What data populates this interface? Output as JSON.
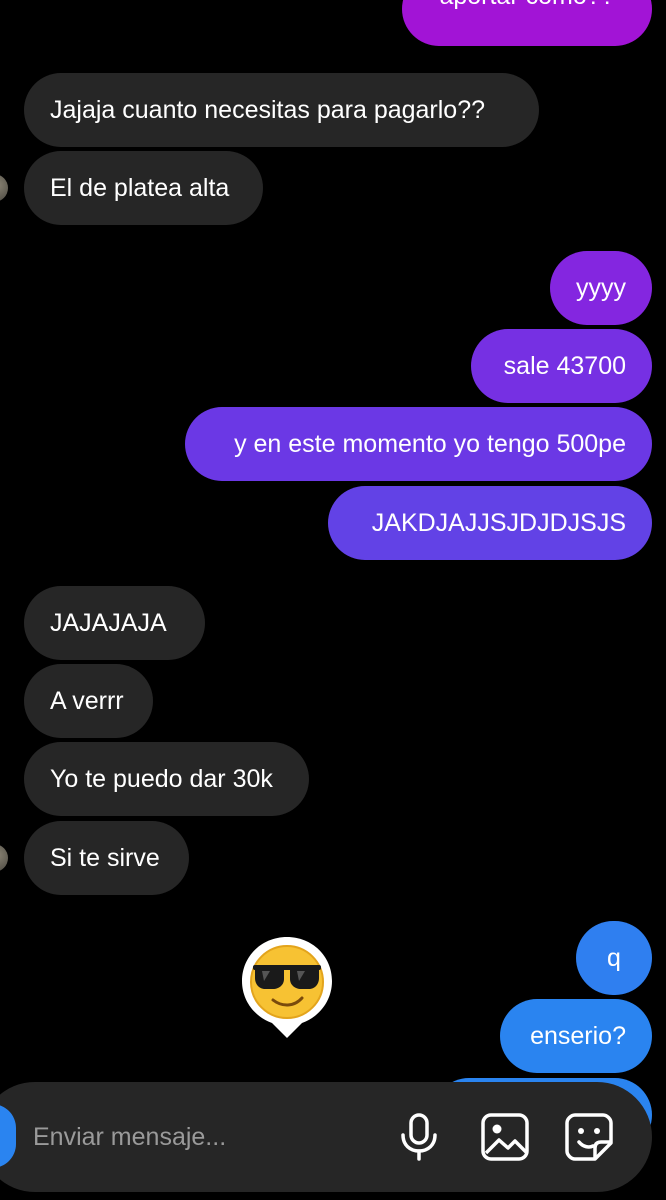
{
  "thread": {
    "partial_top_message": "aportar como??",
    "messages": [
      {
        "from": "them",
        "text": "Jajaja cuanto necesitas para pagarlo??"
      },
      {
        "from": "them",
        "text": "El de platea alta"
      },
      {
        "from": "me",
        "text": "yyyy"
      },
      {
        "from": "me",
        "text": "sale 43700"
      },
      {
        "from": "me",
        "text": "y en este momento yo tengo 500pe"
      },
      {
        "from": "me",
        "text": "JAKDJAJJSJDJDJSJS"
      },
      {
        "from": "them",
        "text": "JAJAJAJA"
      },
      {
        "from": "them",
        "text": "A verrr"
      },
      {
        "from": "them",
        "text": "Yo te puedo dar 30k"
      },
      {
        "from": "them",
        "text": "Si te sirve"
      },
      {
        "from": "me",
        "text": "q"
      },
      {
        "from": "me",
        "text": "enserio?"
      }
    ],
    "reaction_sticker": "sunglasses-face-emoji"
  },
  "composer": {
    "placeholder": "Enviar mensaje...",
    "icons": [
      "camera-icon",
      "microphone-icon",
      "gallery-icon",
      "sticker-icon"
    ]
  },
  "colors": {
    "background": "#000000",
    "incoming_bubble": "#262626",
    "outgoing_purple": "#8f18e0",
    "outgoing_violet": "#6a3ee6",
    "outgoing_blue": "#2f7ff0",
    "camera_button": "#2a84f0"
  }
}
